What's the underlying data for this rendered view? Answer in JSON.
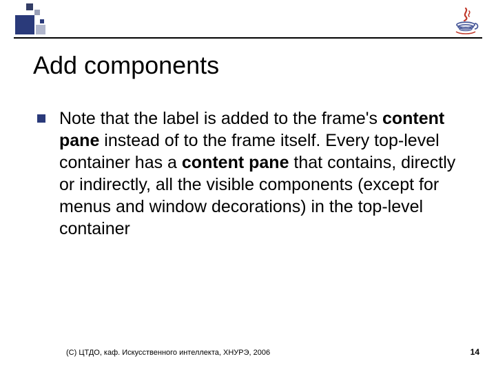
{
  "slide": {
    "title": "Add components",
    "body_parts": [
      "Note that the label is added to the frame's ",
      "content pane",
      " instead of to the frame itself. Every top-level container has a ",
      "content pane",
      " that contains, directly or indirectly, all the visible components (except for menus and window decorations) in the top-level container"
    ],
    "footer": "(С) ЦТДО, каф. Искусственного интеллекта, ХНУРЭ, 2006",
    "page_number": "14"
  }
}
